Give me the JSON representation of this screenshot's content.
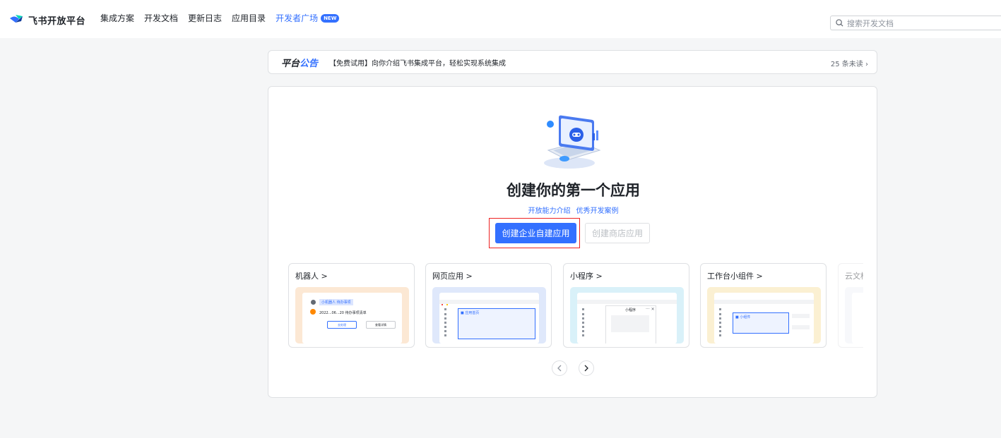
{
  "nav": {
    "brand": "飞书开放平台",
    "links": [
      "集成方案",
      "开发文档",
      "更新日志",
      "应用目录"
    ],
    "active_link": "开发者广场",
    "badge": "NEW",
    "search_placeholder": "搜索开发文档"
  },
  "notice": {
    "title_a": "平台",
    "title_b": "公告",
    "text": "【免费试用】向你介绍飞书集成平台，轻松实现系统集成",
    "unread": "25 条未读"
  },
  "main": {
    "title": "创建你的第一个应用",
    "link_a": "开放能力介绍",
    "link_b": "优秀开发案例",
    "create_internal": "创建企业自建应用",
    "create_store": "创建商店应用"
  },
  "cards": [
    {
      "title": "机器人 >",
      "bg": "#fce8d4",
      "robot_label": "小机器人",
      "robot_tag": "待办事项",
      "robot_item": "2022...06...20  待办事项清单",
      "robot_btn_a": "去处理",
      "robot_btn_b": "查看详情"
    },
    {
      "title": "网页应用 >",
      "bg": "#dfe8fb",
      "web_label": "应用首页"
    },
    {
      "title": "小程序 >",
      "bg": "#d9f1f9",
      "mini_label": "小程序"
    },
    {
      "title": "工作台小组件 >",
      "bg": "#fbf0d2",
      "widget_label": "小组件"
    },
    {
      "title": "云文档 >",
      "bg": "#eef1f8"
    }
  ],
  "colors": {
    "accent": "#3370ff",
    "highlight": "#e22222"
  }
}
